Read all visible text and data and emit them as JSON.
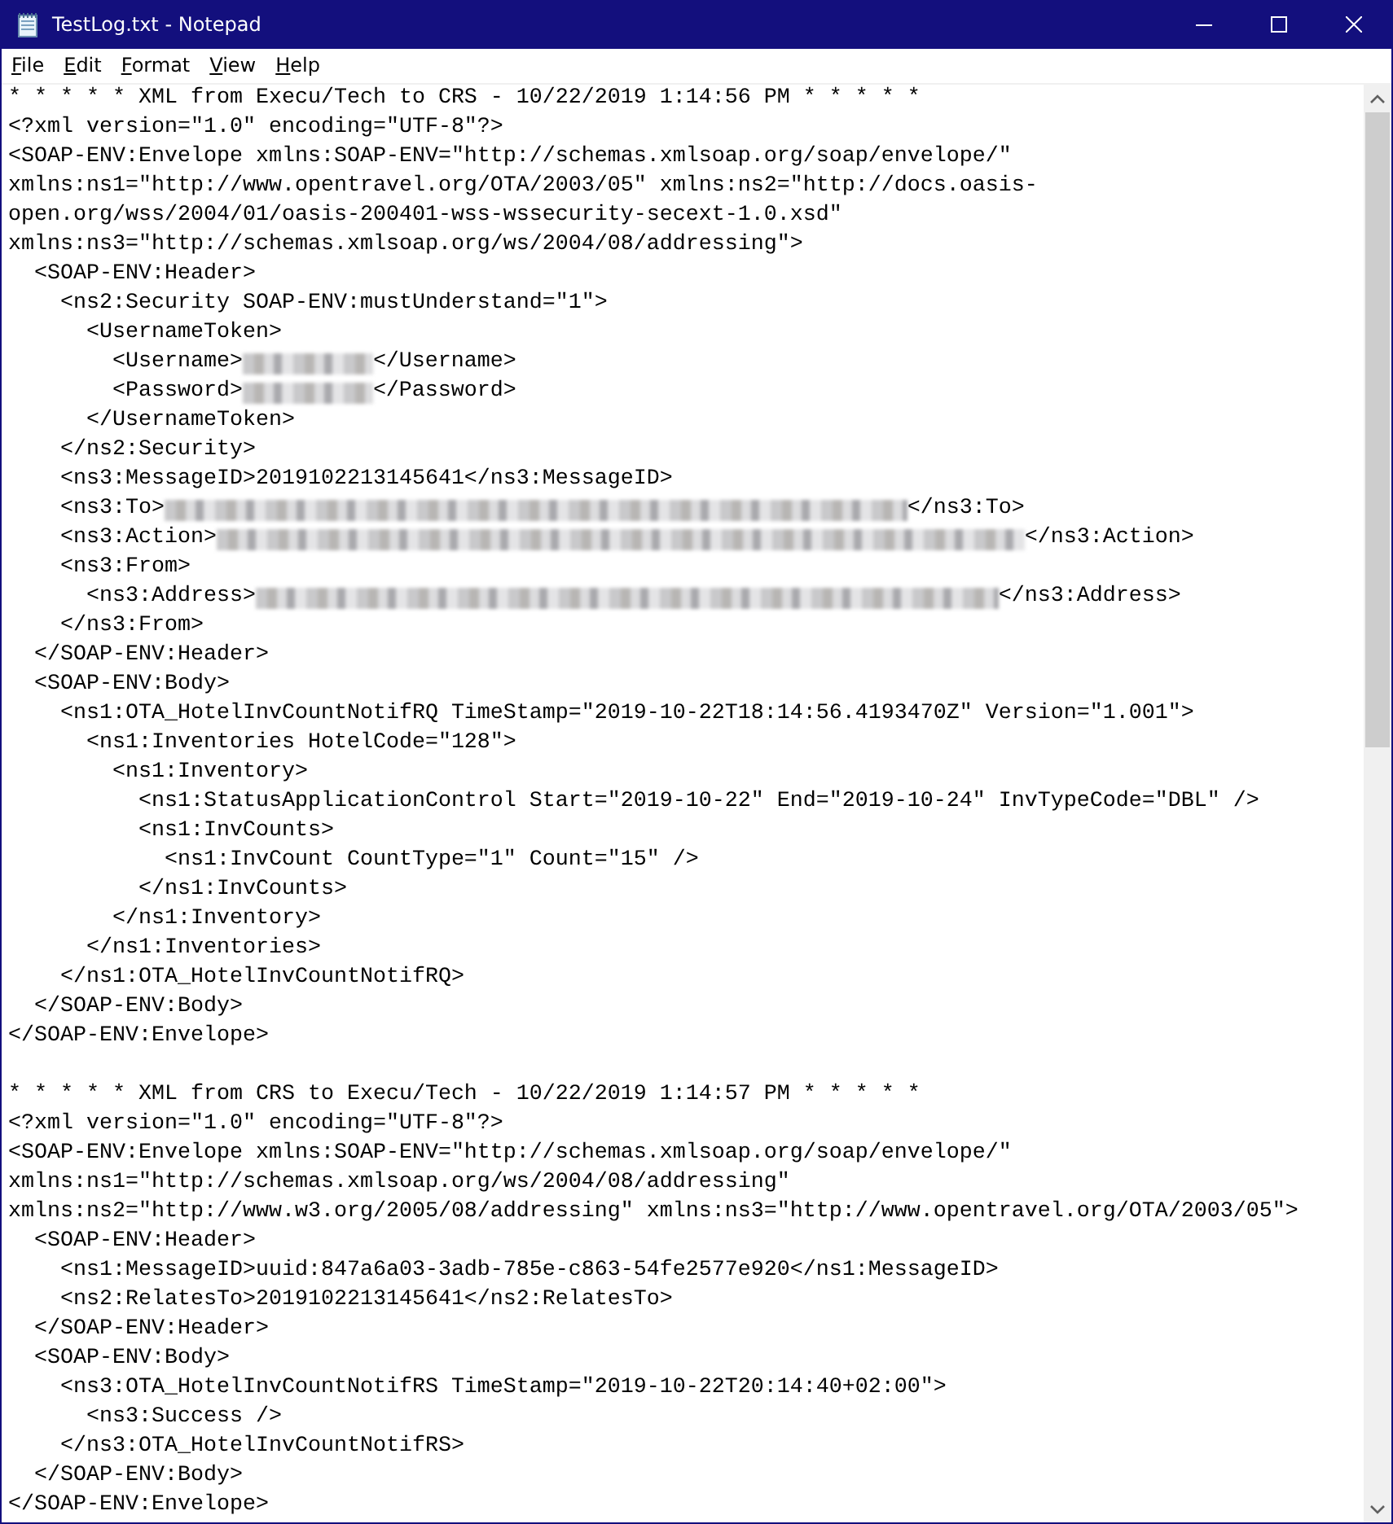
{
  "window": {
    "title": "TestLog.txt - Notepad"
  },
  "menu": [
    {
      "label": "File"
    },
    {
      "label": "Edit"
    },
    {
      "label": "Format"
    },
    {
      "label": "View"
    },
    {
      "label": "Help"
    }
  ],
  "log_entries": [
    {
      "lines": [
        {
          "text": "* * * * * XML from Execu/Tech to CRS - 10/22/2019 1:14:56 PM * * * * *"
        },
        {
          "text": "<?xml version=\"1.0\" encoding=\"UTF-8\"?>"
        },
        {
          "text": "<SOAP-ENV:Envelope xmlns:SOAP-ENV=\"http://schemas.xmlsoap.org/soap/envelope/\""
        },
        {
          "text": "xmlns:ns1=\"http://www.opentravel.org/OTA/2003/05\" xmlns:ns2=\"http://docs.oasis-"
        },
        {
          "text": "open.org/wss/2004/01/oasis-200401-wss-wssecurity-secext-1.0.xsd\""
        },
        {
          "text": "xmlns:ns3=\"http://schemas.xmlsoap.org/ws/2004/08/addressing\">"
        },
        {
          "text": "  <SOAP-ENV:Header>"
        },
        {
          "text": "    <ns2:Security SOAP-ENV:mustUnderstand=\"1\">"
        },
        {
          "text": "      <UsernameToken>"
        },
        {
          "parts": [
            {
              "kind": "text",
              "text": "        <Username>"
            },
            {
              "kind": "redacted"
            },
            {
              "kind": "text",
              "text": "</Username>"
            }
          ]
        },
        {
          "parts": [
            {
              "kind": "text",
              "text": "        <Password>"
            },
            {
              "kind": "redacted"
            },
            {
              "kind": "text",
              "text": "</Password>"
            }
          ]
        },
        {
          "text": "      </UsernameToken>"
        },
        {
          "text": "    </ns2:Security>"
        },
        {
          "text": "    <ns3:MessageID>2019102213145641</ns3:MessageID>"
        },
        {
          "parts": [
            {
              "kind": "text",
              "text": "    <ns3:To>"
            },
            {
              "kind": "redacted"
            },
            {
              "kind": "text",
              "text": "</ns3:To>"
            }
          ]
        },
        {
          "parts": [
            {
              "kind": "text",
              "text": "    <ns3:Action>"
            },
            {
              "kind": "redacted"
            },
            {
              "kind": "text",
              "text": "</ns3:Action>"
            }
          ]
        },
        {
          "text": "    <ns3:From>"
        },
        {
          "parts": [
            {
              "kind": "text",
              "text": "      <ns3:Address>"
            },
            {
              "kind": "redacted"
            },
            {
              "kind": "text",
              "text": "</ns3:Address>"
            }
          ]
        },
        {
          "text": "    </ns3:From>"
        },
        {
          "text": "  </SOAP-ENV:Header>"
        },
        {
          "text": "  <SOAP-ENV:Body>"
        },
        {
          "text": "    <ns1:OTA_HotelInvCountNotifRQ TimeStamp=\"2019-10-22T18:14:56.4193470Z\" Version=\"1.001\">"
        },
        {
          "text": "      <ns1:Inventories HotelCode=\"128\">"
        },
        {
          "text": "        <ns1:Inventory>"
        },
        {
          "text": "          <ns1:StatusApplicationControl Start=\"2019-10-22\" End=\"2019-10-24\" InvTypeCode=\"DBL\" />"
        },
        {
          "text": "          <ns1:InvCounts>"
        },
        {
          "text": "            <ns1:InvCount CountType=\"1\" Count=\"15\" />"
        },
        {
          "text": "          </ns1:InvCounts>"
        },
        {
          "text": "        </ns1:Inventory>"
        },
        {
          "text": "      </ns1:Inventories>"
        },
        {
          "text": "    </ns1:OTA_HotelInvCountNotifRQ>"
        },
        {
          "text": "  </SOAP-ENV:Body>"
        },
        {
          "text": "</SOAP-ENV:Envelope>"
        }
      ]
    },
    {
      "lines": [
        {
          "text": "* * * * * XML from CRS to Execu/Tech - 10/22/2019 1:14:57 PM * * * * *"
        },
        {
          "text": "<?xml version=\"1.0\" encoding=\"UTF-8\"?>"
        },
        {
          "text": "<SOAP-ENV:Envelope xmlns:SOAP-ENV=\"http://schemas.xmlsoap.org/soap/envelope/\""
        },
        {
          "text": "xmlns:ns1=\"http://schemas.xmlsoap.org/ws/2004/08/addressing\""
        },
        {
          "text": "xmlns:ns2=\"http://www.w3.org/2005/08/addressing\" xmlns:ns3=\"http://www.opentravel.org/OTA/2003/05\">"
        },
        {
          "text": "  <SOAP-ENV:Header>"
        },
        {
          "text": "    <ns1:MessageID>uuid:847a6a03-3adb-785e-c863-54fe2577e920</ns1:MessageID>"
        },
        {
          "text": "    <ns2:RelatesTo>2019102213145641</ns2:RelatesTo>"
        },
        {
          "text": "  </SOAP-ENV:Header>"
        },
        {
          "text": "  <SOAP-ENV:Body>"
        },
        {
          "text": "    <ns3:OTA_HotelInvCountNotifRS TimeStamp=\"2019-10-22T20:14:40+02:00\">"
        },
        {
          "text": "      <ns3:Success />"
        },
        {
          "text": "    </ns3:OTA_HotelInvCountNotifRS>"
        },
        {
          "text": "  </SOAP-ENV:Body>"
        },
        {
          "text": "</SOAP-ENV:Envelope>"
        }
      ]
    }
  ]
}
